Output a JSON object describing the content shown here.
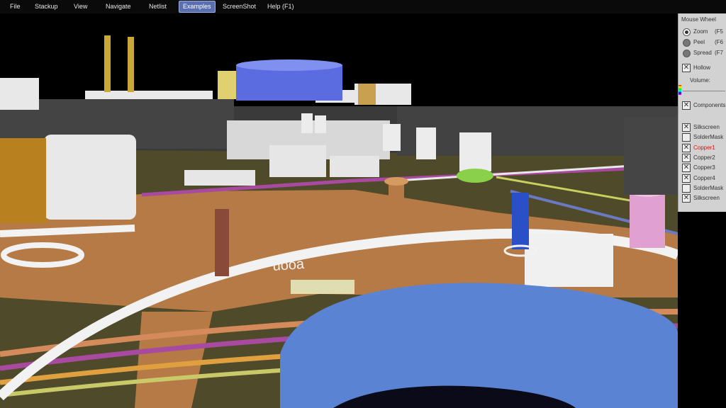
{
  "menu": {
    "file": "File",
    "stackup": "Stackup",
    "view": "View",
    "navigate": "Navigate",
    "netlist": "Netlist",
    "examples": "Examples",
    "screenshot": "ScreenShot",
    "help": "Help (F1)"
  },
  "panel": {
    "mouse_wheel_title": "Mouse Wheel",
    "zoom": "Zoom",
    "zoom_key": "(F5",
    "peel": "Peel",
    "peel_key": "(F6",
    "spread": "Spread",
    "spread_key": "(F7",
    "hollow": "Hollow",
    "volume": "Volume:",
    "components": "Components",
    "layers": [
      {
        "label": "Silkscreen",
        "checked": true,
        "active": false
      },
      {
        "label": "SolderMask",
        "checked": false,
        "active": false
      },
      {
        "label": "Copper1",
        "checked": true,
        "active": true
      },
      {
        "label": "Copper2",
        "checked": true,
        "active": false
      },
      {
        "label": "Copper3",
        "checked": true,
        "active": false
      },
      {
        "label": "Copper4",
        "checked": true,
        "active": false
      },
      {
        "label": "SolderMask",
        "checked": false,
        "active": false
      },
      {
        "label": "Silkscreen",
        "checked": true,
        "active": false
      }
    ]
  },
  "board": {
    "silk_text": "uooa"
  },
  "colors": {
    "board": "#4e4a2a",
    "copper": "#b57a45",
    "active_menu": "#5a6fb0",
    "panel_bg": "#d2d2d2",
    "capacitor_blue": "#5b83d4"
  }
}
